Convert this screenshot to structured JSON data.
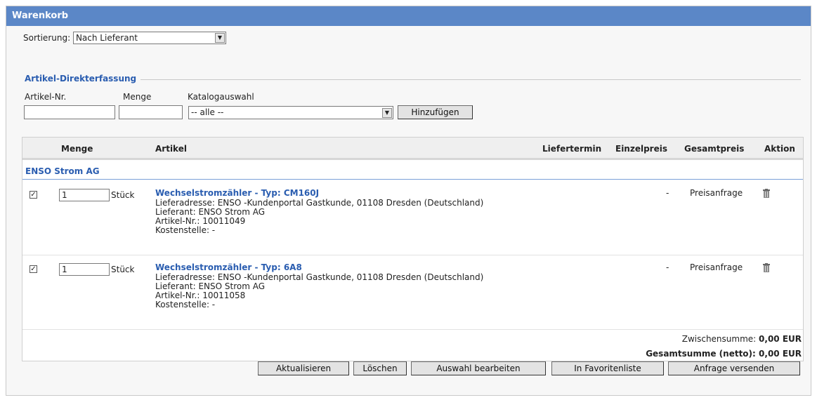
{
  "window": {
    "title": "Warenkorb"
  },
  "sort": {
    "label": "Sortierung:",
    "value": "Nach Lieferant"
  },
  "direct": {
    "title": "Artikel-Direkterfassung",
    "artnr_label": "Artikel-Nr.",
    "menge_label": "Menge",
    "katalog_label": "Katalogauswahl",
    "katalog_value": "-- alle --",
    "add_button": "Hinzufügen"
  },
  "table": {
    "headers": {
      "menge": "Menge",
      "artikel": "Artikel",
      "liefertermin": "Liefertermin",
      "einzelpreis": "Einzelpreis",
      "gesamtpreis": "Gesamtpreis",
      "aktion": "Aktion"
    },
    "group": "ENSO Strom AG",
    "rows": [
      {
        "qty": "1",
        "unit": "Stück",
        "title": "Wechselstromzähler - Typ: CM160J",
        "lieferadresse": "Lieferadresse: ENSO -Kundenportal Gastkunde, 01108 Dresden (Deutschland)",
        "lieferant": "Lieferant: ENSO Strom AG",
        "artnr": "Artikel-Nr.: 10011049",
        "kostenstelle": "Kostenstelle: -",
        "einzelpreis": "-",
        "gesamtpreis": "Preisanfrage"
      },
      {
        "qty": "1",
        "unit": "Stück",
        "title": "Wechselstromzähler - Typ: 6A8",
        "lieferadresse": "Lieferadresse: ENSO -Kundenportal Gastkunde, 01108 Dresden (Deutschland)",
        "lieferant": "Lieferant: ENSO Strom AG",
        "artnr": "Artikel-Nr.: 10011058",
        "kostenstelle": "Kostenstelle: -",
        "einzelpreis": "-",
        "gesamtpreis": "Preisanfrage"
      }
    ],
    "zwischensumme_label": "Zwischensumme:",
    "zwischensumme_value": "0,00 EUR",
    "gesamtsumme_label": "Gesamtsumme (netto):",
    "gesamtsumme_value": "0,00 EUR"
  },
  "buttons": {
    "aktualisieren": "Aktualisieren",
    "loeschen": "Löschen",
    "auswahl": "Auswahl bearbeiten",
    "favoriten": "In Favoritenliste",
    "anfrage": "Anfrage versenden"
  },
  "icons": {
    "checkbox": "checkmark-icon",
    "dropdown": "chevron-down-icon",
    "delete": "trash-icon"
  },
  "colors": {
    "titlebar": "#5b87c7",
    "link": "#2a5db0"
  }
}
